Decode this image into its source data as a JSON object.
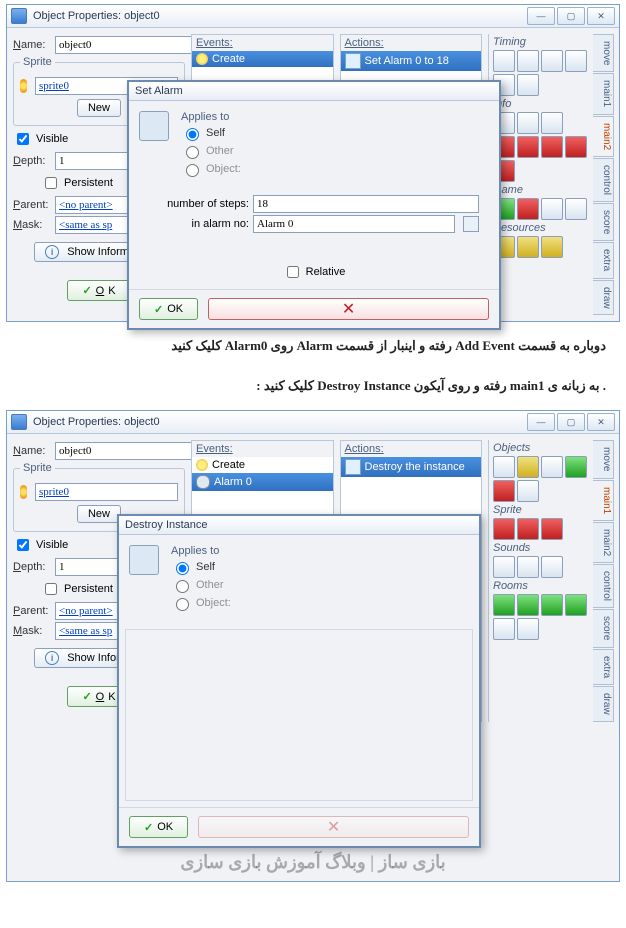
{
  "win1": {
    "title": "Object Properties: object0",
    "name_lbl": "Name:",
    "name_val": "object0",
    "sprite_title": "Sprite",
    "sprite_val": "sprite0",
    "new_btn": "New",
    "visible": "Visible",
    "depth_lbl": "Depth:",
    "depth_val": "1",
    "persistent": "Persistent",
    "parent_lbl": "Parent:",
    "parent_val": "<no parent>",
    "mask_lbl": "Mask:",
    "mask_val": "<same as sp",
    "showinfo": "Show Information",
    "ok": "OK",
    "events_lbl": "Events:",
    "ev_create": "Create",
    "actions_lbl": "Actions:",
    "act_setalarm": "Set Alarm 0 to 18",
    "cats": {
      "timing": "Timing",
      "info": "Info",
      "game": "Game",
      "res": "Resources",
      "objects": "Objects",
      "sprite": "Sprite",
      "sounds": "Sounds",
      "rooms": "Rooms"
    },
    "tabs": {
      "move": "move",
      "main1": "main1",
      "main2": "main2",
      "control": "control",
      "score": "score",
      "extra": "extra",
      "draw": "draw"
    }
  },
  "dlg1": {
    "title": "Set Alarm",
    "applies": "Applies to",
    "self": "Self",
    "other": "Other",
    "object": "Object:",
    "steps_lbl": "number of steps:",
    "steps_val": "18",
    "alarm_lbl": "in alarm no:",
    "alarm_val": "Alarm 0",
    "relative": "Relative",
    "ok": "OK"
  },
  "instr1": "دوباره به قسمت Add Event رفته و اینبار از قسمت Alarm روی Alarm0 کلیک کنید",
  "instr2": ". به زبانه ی main1 رفته و روی آیکون Destroy Instance کلیک کنید :",
  "win2": {
    "title": "Object Properties: object0",
    "ev_create": "Create",
    "ev_alarm": "Alarm 0",
    "act_destroy": "Destroy the instance"
  },
  "dlg2": {
    "title": "Destroy Instance",
    "applies": "Applies to",
    "self": "Self",
    "other": "Other",
    "object": "Object:",
    "ok": "OK"
  },
  "watermark": "بازی ساز | وبلاگ آموزش بازی سازی"
}
